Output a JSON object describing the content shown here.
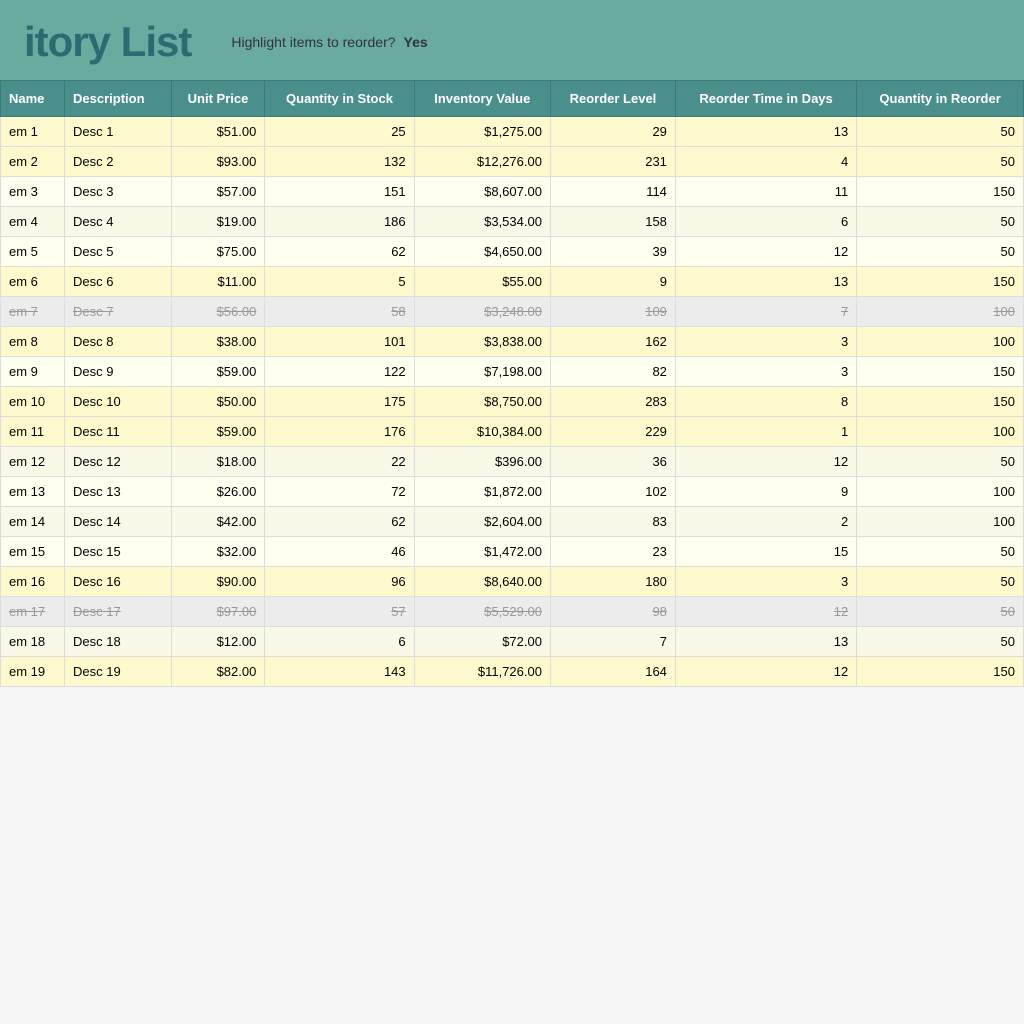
{
  "header": {
    "title": "itory List",
    "highlight_question": "Highlight items to reorder?",
    "highlight_answer": "Yes"
  },
  "columns": [
    "Name",
    "Description",
    "Unit Price",
    "Quantity in Stock",
    "Inventory Value",
    "Reorder Level",
    "Reorder Time in Days",
    "Quantity in Reorder"
  ],
  "rows": [
    {
      "name": "em 1",
      "desc": "Desc 1",
      "unit_price": "$51.00",
      "qty_stock": 25,
      "inv_value": "$1,275.00",
      "reorder_level": 29,
      "reorder_days": 13,
      "qty_reorder": 50,
      "strikethrough": false,
      "highlight": true
    },
    {
      "name": "em 2",
      "desc": "Desc 2",
      "unit_price": "$93.00",
      "qty_stock": 132,
      "inv_value": "$12,276.00",
      "reorder_level": 231,
      "reorder_days": 4,
      "qty_reorder": 50,
      "strikethrough": false,
      "highlight": true
    },
    {
      "name": "em 3",
      "desc": "Desc 3",
      "unit_price": "$57.00",
      "qty_stock": 151,
      "inv_value": "$8,607.00",
      "reorder_level": 114,
      "reorder_days": 11,
      "qty_reorder": 150,
      "strikethrough": false,
      "highlight": false
    },
    {
      "name": "em 4",
      "desc": "Desc 4",
      "unit_price": "$19.00",
      "qty_stock": 186,
      "inv_value": "$3,534.00",
      "reorder_level": 158,
      "reorder_days": 6,
      "qty_reorder": 50,
      "strikethrough": false,
      "highlight": false
    },
    {
      "name": "em 5",
      "desc": "Desc 5",
      "unit_price": "$75.00",
      "qty_stock": 62,
      "inv_value": "$4,650.00",
      "reorder_level": 39,
      "reorder_days": 12,
      "qty_reorder": 50,
      "strikethrough": false,
      "highlight": false
    },
    {
      "name": "em 6",
      "desc": "Desc 6",
      "unit_price": "$11.00",
      "qty_stock": 5,
      "inv_value": "$55.00",
      "reorder_level": 9,
      "reorder_days": 13,
      "qty_reorder": 150,
      "strikethrough": false,
      "highlight": true
    },
    {
      "name": "em 7",
      "desc": "Desc 7",
      "unit_price": "$56.00",
      "qty_stock": 58,
      "inv_value": "$3,248.00",
      "reorder_level": 109,
      "reorder_days": 7,
      "qty_reorder": 100,
      "strikethrough": true,
      "highlight": false
    },
    {
      "name": "em 8",
      "desc": "Desc 8",
      "unit_price": "$38.00",
      "qty_stock": 101,
      "inv_value": "$3,838.00",
      "reorder_level": 162,
      "reorder_days": 3,
      "qty_reorder": 100,
      "strikethrough": false,
      "highlight": true
    },
    {
      "name": "em 9",
      "desc": "Desc 9",
      "unit_price": "$59.00",
      "qty_stock": 122,
      "inv_value": "$7,198.00",
      "reorder_level": 82,
      "reorder_days": 3,
      "qty_reorder": 150,
      "strikethrough": false,
      "highlight": false
    },
    {
      "name": "em 10",
      "desc": "Desc 10",
      "unit_price": "$50.00",
      "qty_stock": 175,
      "inv_value": "$8,750.00",
      "reorder_level": 283,
      "reorder_days": 8,
      "qty_reorder": 150,
      "strikethrough": false,
      "highlight": true
    },
    {
      "name": "em 11",
      "desc": "Desc 11",
      "unit_price": "$59.00",
      "qty_stock": 176,
      "inv_value": "$10,384.00",
      "reorder_level": 229,
      "reorder_days": 1,
      "qty_reorder": 100,
      "strikethrough": false,
      "highlight": true
    },
    {
      "name": "em 12",
      "desc": "Desc 12",
      "unit_price": "$18.00",
      "qty_stock": 22,
      "inv_value": "$396.00",
      "reorder_level": 36,
      "reorder_days": 12,
      "qty_reorder": 50,
      "strikethrough": false,
      "highlight": false
    },
    {
      "name": "em 13",
      "desc": "Desc 13",
      "unit_price": "$26.00",
      "qty_stock": 72,
      "inv_value": "$1,872.00",
      "reorder_level": 102,
      "reorder_days": 9,
      "qty_reorder": 100,
      "strikethrough": false,
      "highlight": false
    },
    {
      "name": "em 14",
      "desc": "Desc 14",
      "unit_price": "$42.00",
      "qty_stock": 62,
      "inv_value": "$2,604.00",
      "reorder_level": 83,
      "reorder_days": 2,
      "qty_reorder": 100,
      "strikethrough": false,
      "highlight": false
    },
    {
      "name": "em 15",
      "desc": "Desc 15",
      "unit_price": "$32.00",
      "qty_stock": 46,
      "inv_value": "$1,472.00",
      "reorder_level": 23,
      "reorder_days": 15,
      "qty_reorder": 50,
      "strikethrough": false,
      "highlight": false
    },
    {
      "name": "em 16",
      "desc": "Desc 16",
      "unit_price": "$90.00",
      "qty_stock": 96,
      "inv_value": "$8,640.00",
      "reorder_level": 180,
      "reorder_days": 3,
      "qty_reorder": 50,
      "strikethrough": false,
      "highlight": true
    },
    {
      "name": "em 17",
      "desc": "Desc 17",
      "unit_price": "$97.00",
      "qty_stock": 57,
      "inv_value": "$5,529.00",
      "reorder_level": 98,
      "reorder_days": 12,
      "qty_reorder": 50,
      "strikethrough": true,
      "highlight": false
    },
    {
      "name": "em 18",
      "desc": "Desc 18",
      "unit_price": "$12.00",
      "qty_stock": 6,
      "inv_value": "$72.00",
      "reorder_level": 7,
      "reorder_days": 13,
      "qty_reorder": 50,
      "strikethrough": false,
      "highlight": false
    },
    {
      "name": "em 19",
      "desc": "Desc 19",
      "unit_price": "$82.00",
      "qty_stock": 143,
      "inv_value": "$11,726.00",
      "reorder_level": 164,
      "reorder_days": 12,
      "qty_reorder": 150,
      "strikethrough": false,
      "highlight": true
    }
  ]
}
